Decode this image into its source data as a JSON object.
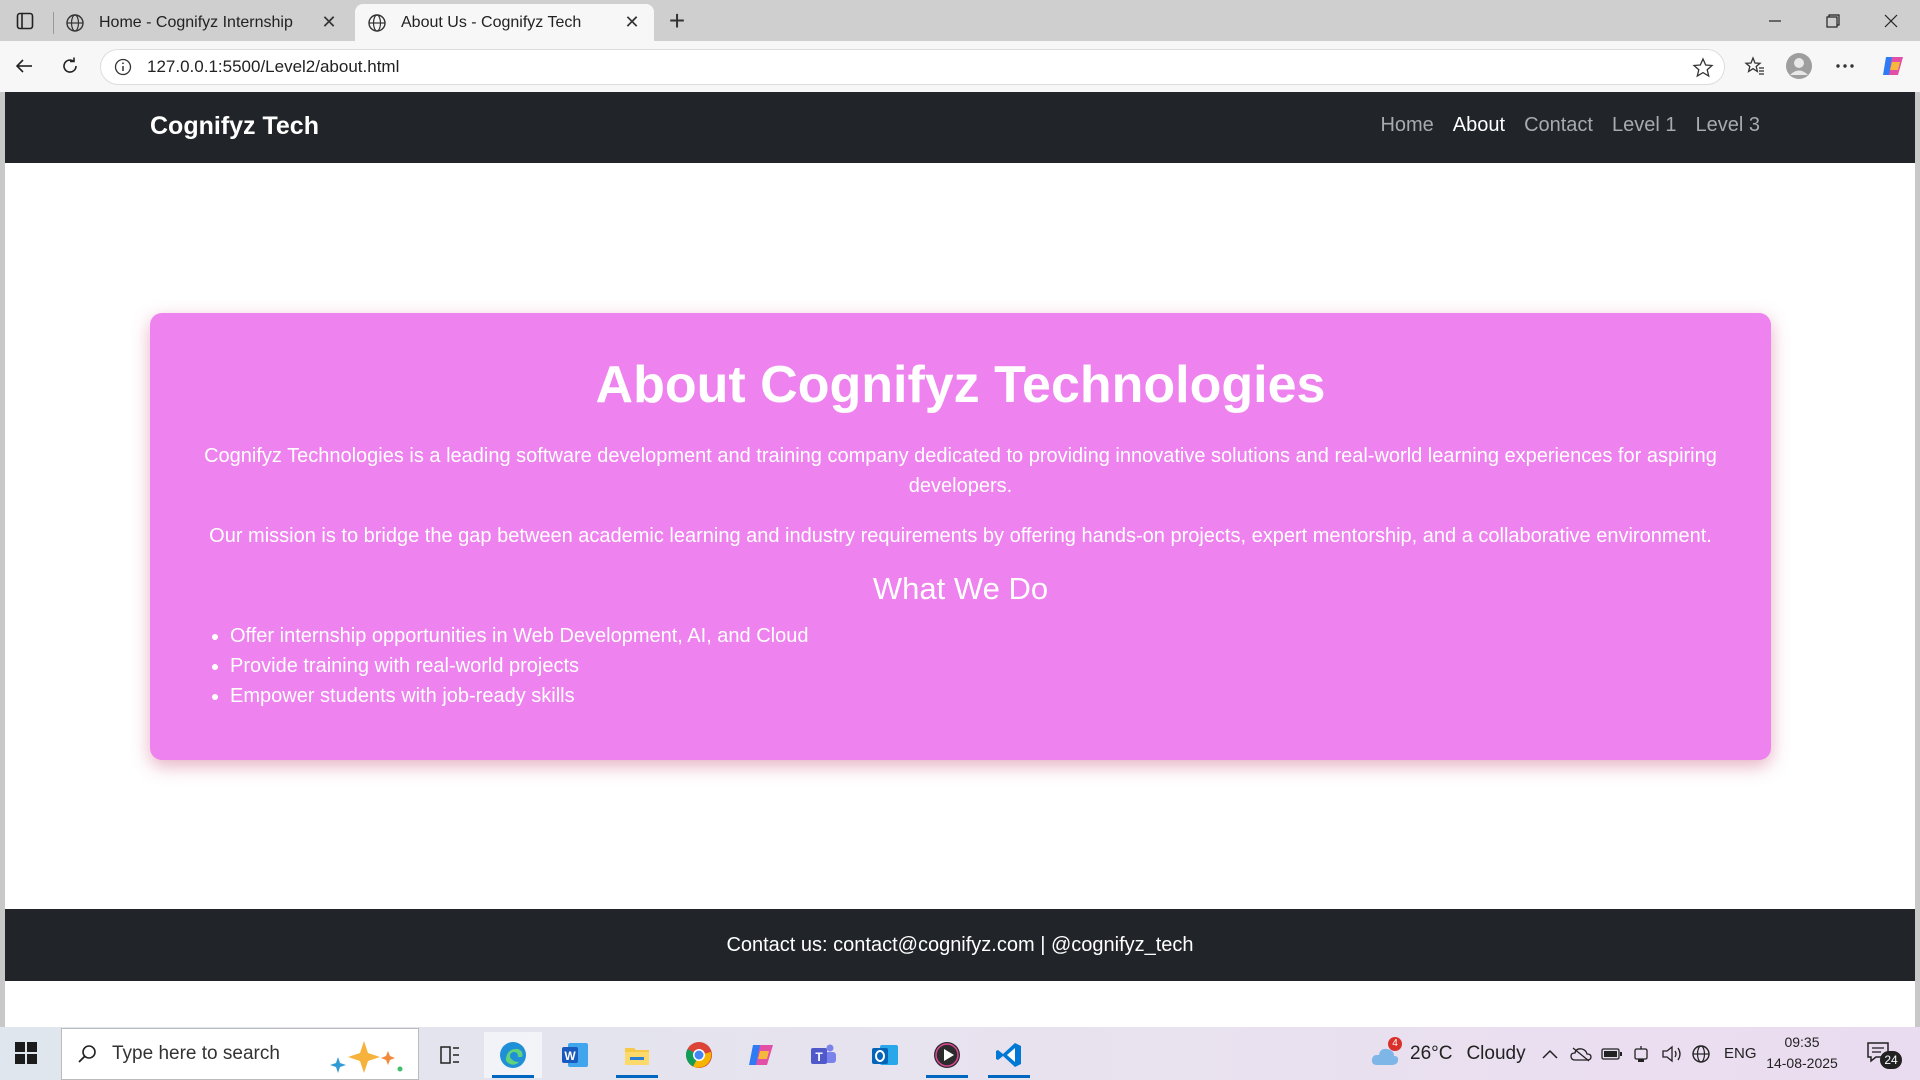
{
  "browser": {
    "tabs": [
      {
        "title": "Home - Cognifyz Internship",
        "active": false
      },
      {
        "title": "About Us - Cognifyz Tech",
        "active": true
      }
    ],
    "url": "127.0.0.1:5500/Level2/about.html"
  },
  "site": {
    "brand": "Cognifyz Tech",
    "nav": [
      {
        "label": "Home",
        "active": false
      },
      {
        "label": "About",
        "active": true
      },
      {
        "label": "Contact",
        "active": false
      },
      {
        "label": "Level 1",
        "active": false
      },
      {
        "label": "Level 3",
        "active": false
      }
    ],
    "about": {
      "heading": "About Cognifyz Technologies",
      "intro": "Cognifyz Technologies is a leading software development and training company dedicated to providing innovative solutions and real-world learning experiences for aspiring developers.",
      "mission": "Our mission is to bridge the gap between academic learning and industry requirements by offering hands-on projects, expert mentorship, and a collaborative environment.",
      "subheading": "What We Do",
      "items": [
        "Offer internship opportunities in Web Development, AI, and Cloud",
        "Provide training with real-world projects",
        "Empower students with job-ready skills"
      ]
    },
    "footer": "Contact us: contact@cognifyz.com | @cognifyz_tech",
    "colors": {
      "nav_bg": "#212529",
      "card_bg": "#ee82ee"
    }
  },
  "taskbar": {
    "search_placeholder": "Type here to search",
    "weather": {
      "temp": "26°C",
      "condition": "Cloudy",
      "badge": "4"
    },
    "language": "ENG",
    "time": "09:35",
    "date": "14-08-2025",
    "notifications": "24"
  }
}
